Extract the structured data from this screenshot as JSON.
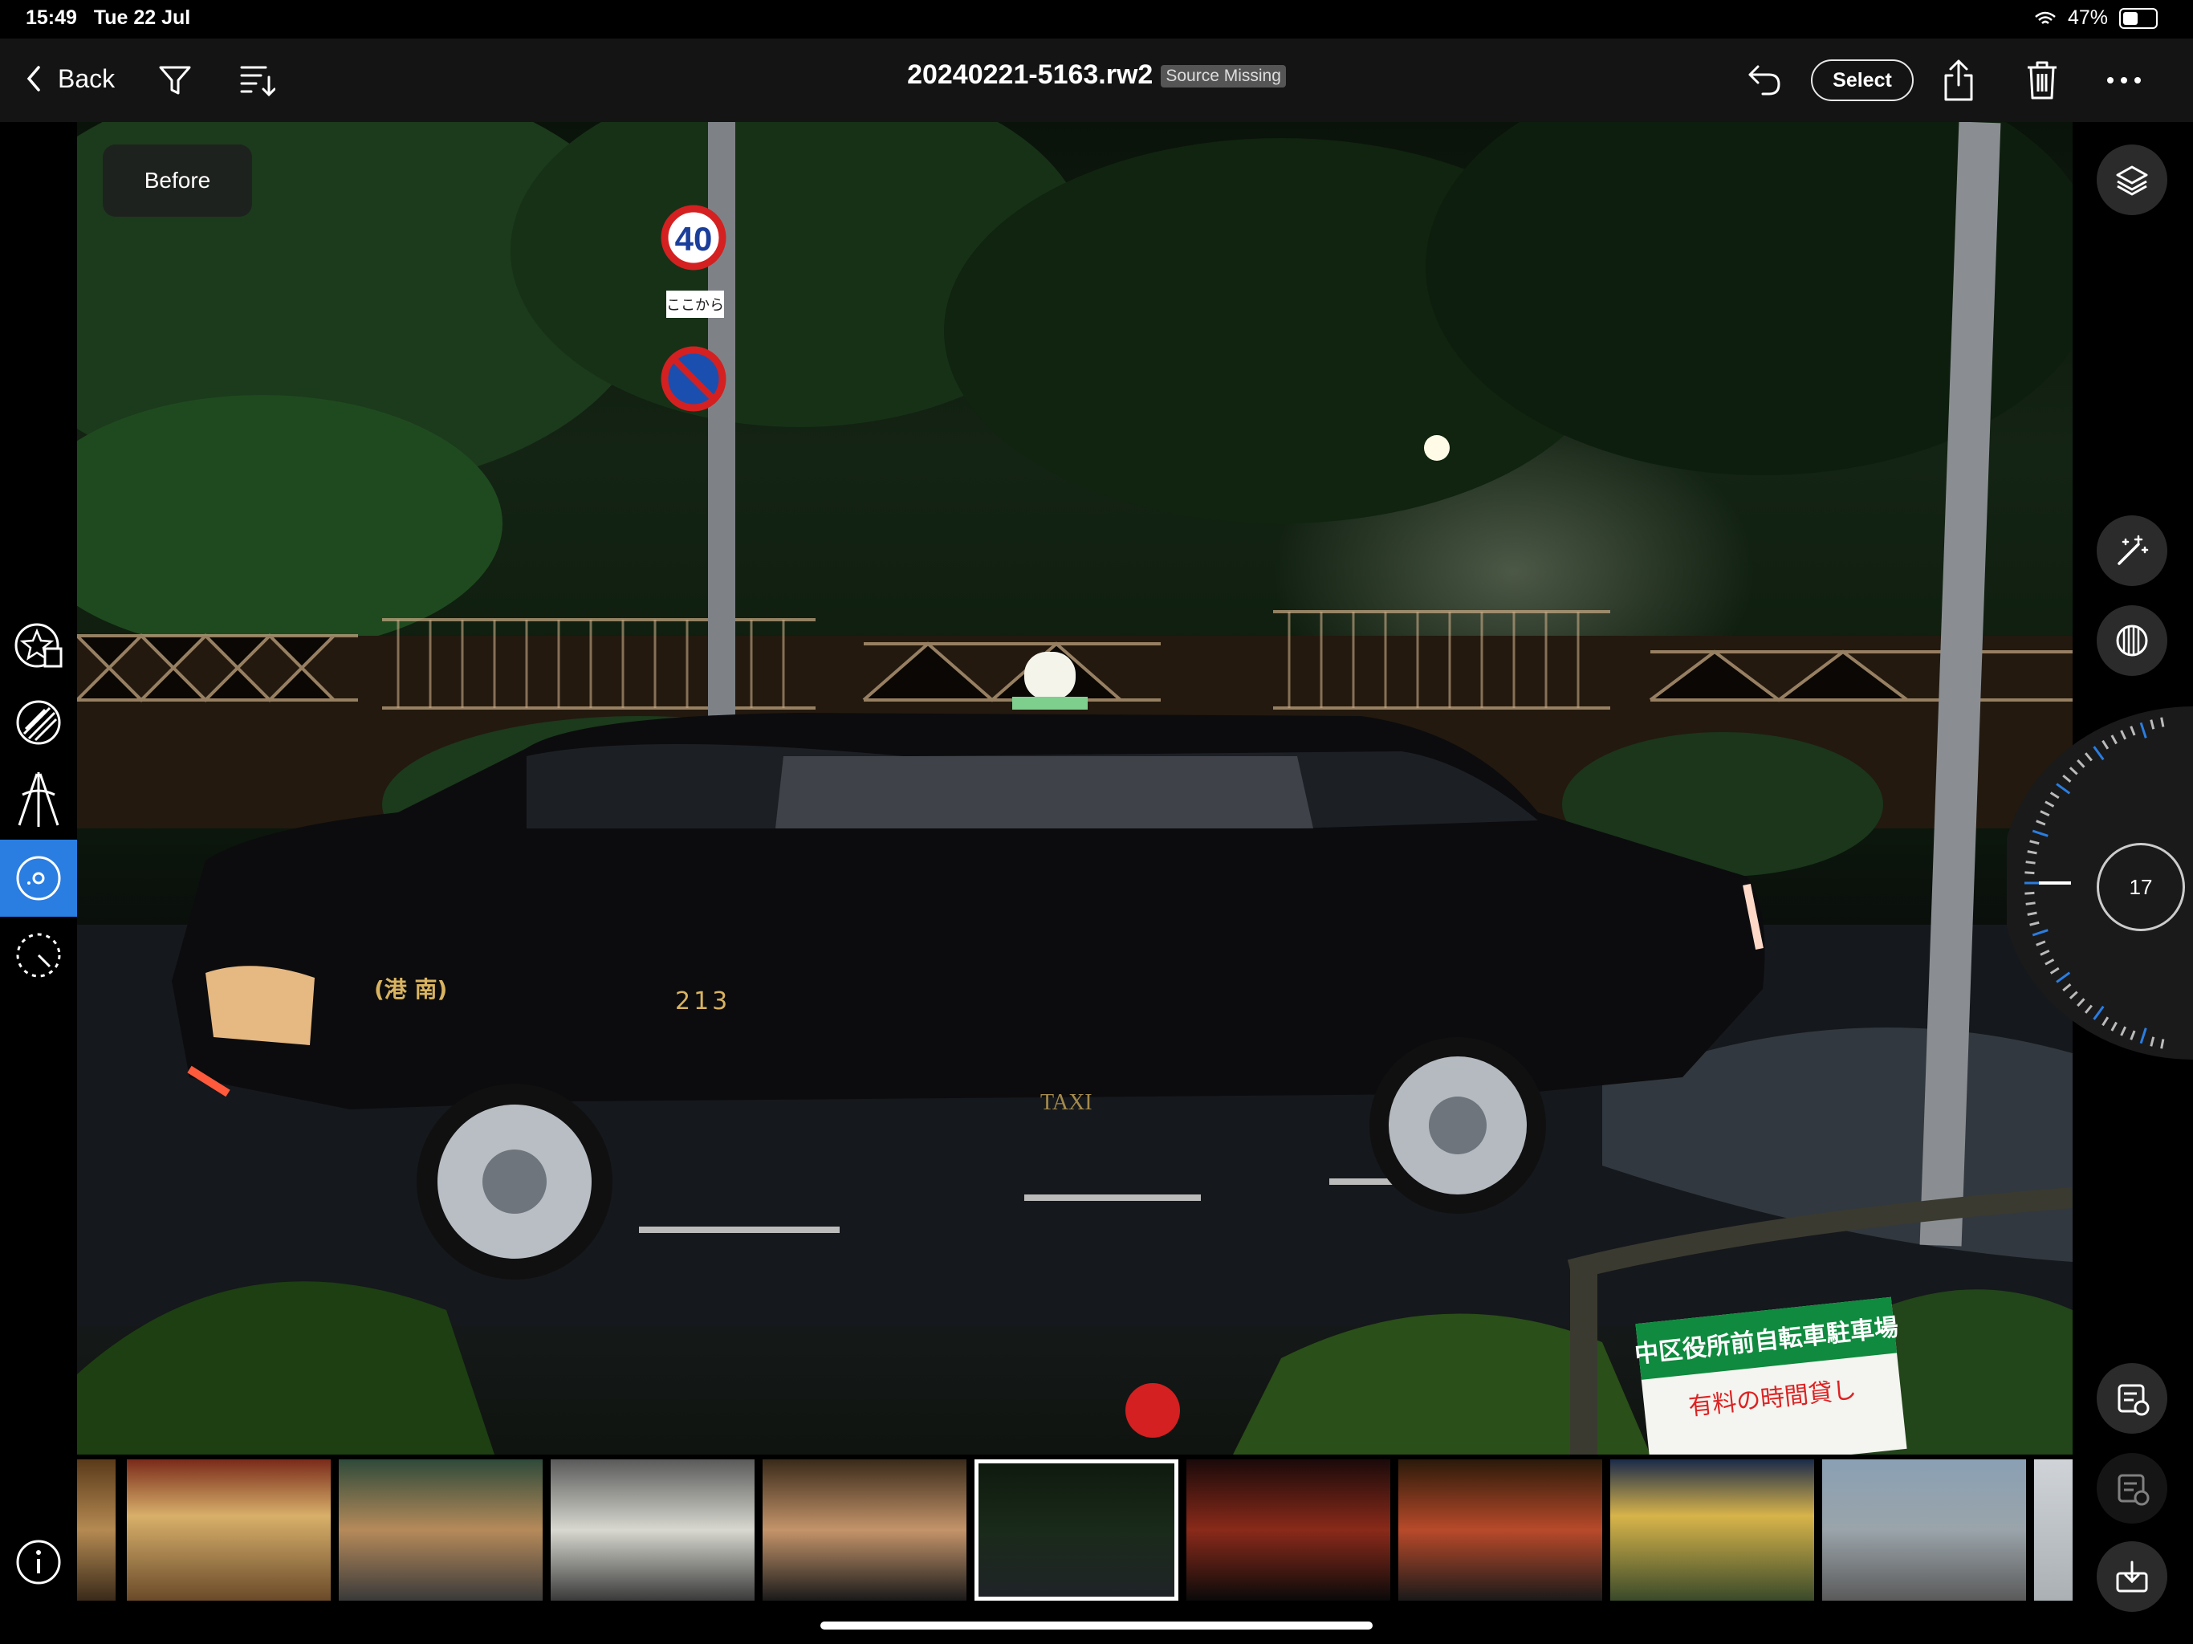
{
  "status_bar": {
    "time": "15:49",
    "date": "Tue 22 Jul",
    "battery": "47%",
    "battery_level": 0.47
  },
  "nav": {
    "back_label": "Back",
    "title": "20240221-5163.rw2",
    "badge": "Source Missing",
    "select_label": "Select"
  },
  "photo": {
    "before_label": "Before",
    "taxi_number": "213",
    "taxi_name": "(港 南)",
    "taxi_word": "TAXI",
    "speed_sign": "40",
    "sign_small": "ここから",
    "parking_sign_line1": "中区役所前自転車駐車場",
    "parking_sign_line2": "有料の時間貸し"
  },
  "dial": {
    "value": "17"
  },
  "icons": {
    "back": "chevron-left-icon",
    "filter": "filter-icon",
    "sort": "sort-icon",
    "undo": "undo-icon",
    "share": "share-icon",
    "trash": "trash-icon",
    "more": "more-icon",
    "layers": "layers-icon",
    "auto": "magic-wand-icon",
    "mask": "mask-icon",
    "presets": "presets-icon",
    "light": "light-icon",
    "geometry": "geometry-icon",
    "color": "color-icon",
    "selective": "selective-icon",
    "info": "info-icon",
    "compare": "compare-icon",
    "versions": "versions-icon",
    "export": "export-icon"
  },
  "colors": {
    "accent": "#2a7de1",
    "nav_bg": "#141414"
  }
}
